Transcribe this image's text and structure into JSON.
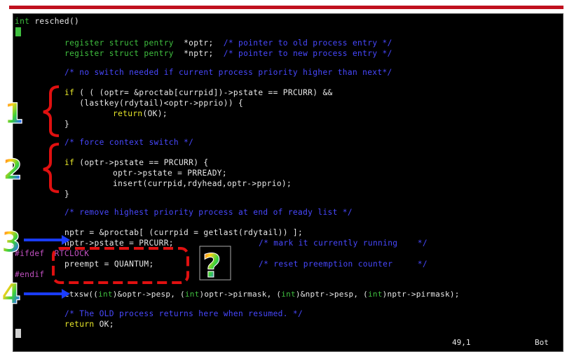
{
  "colors": {
    "top_bar": "#c0101e",
    "terminal_bg": "#000000",
    "comment": "#4848ff",
    "type": "#3fbf3f",
    "keyword": "#e8e82a",
    "preproc": "#c050c0",
    "annotation_red": "#e01010",
    "annotation_blue": "#1a3cff"
  },
  "code": {
    "l1_type": "int",
    "l1_name": " resched()",
    "l3_type": "register struct pentry  ",
    "l3_var": "*optr;  ",
    "l3_comment": "/* pointer to old process entry */",
    "l4_type": "register struct pentry  ",
    "l4_var": "*nptr;  ",
    "l4_comment": "/* pointer to new process entry */",
    "l6_comment": "/* no switch needed if current process priority higher than next*/",
    "l8_kw": "if",
    "l8_rest": " ( ( (optr= &proctab[currpid])->pstate == PRCURR) &&",
    "l9": "   (lastkey(rdytail)<optr->pprio)) {",
    "l10_kw": "return",
    "l10_rest": "(OK);",
    "l11": "}",
    "l12_comment": "/* force context switch */",
    "l14_kw": "if",
    "l14_rest": " (optr->pstate == PRCURR) {",
    "l15": "optr->pstate = PRREADY;",
    "l16": "insert(currpid,rdyhead,optr->pprio);",
    "l17": "}",
    "l19_comment": "/* remove highest priority process at end of ready list */",
    "l21": "nptr = &proctab[ (currpid = getlast(rdytail)) ];",
    "l22": "nptr->pstate = PRCURR;",
    "l22_comment": "/* mark it currently running    */",
    "l23_pp": "#ifdef",
    "l23_rest": "  RTCLOCK",
    "l24": "preempt = QUANTUM;",
    "l24_comment": "/* reset preemption counter     */",
    "l25_pp": "#endif",
    "l26_a": "ctxsw((",
    "l26_t1": "int",
    "l26_b": ")&optr->pesp, (",
    "l26_t2": "int",
    "l26_c": ")optr->pirmask, (",
    "l26_t3": "int",
    "l26_d": ")&nptr->pesp, (",
    "l26_t4": "int",
    "l26_e": ")nptr->pirmask);",
    "l28_comment": "/* The OLD process returns here when resumed. */",
    "l29_kw": "return",
    "l29_rest": " OK;"
  },
  "status": {
    "position": "49,1",
    "scroll": "Bot"
  },
  "annotations": {
    "n1": "1",
    "n2": "2",
    "n3": "3",
    "n4": "4",
    "question": "?"
  }
}
